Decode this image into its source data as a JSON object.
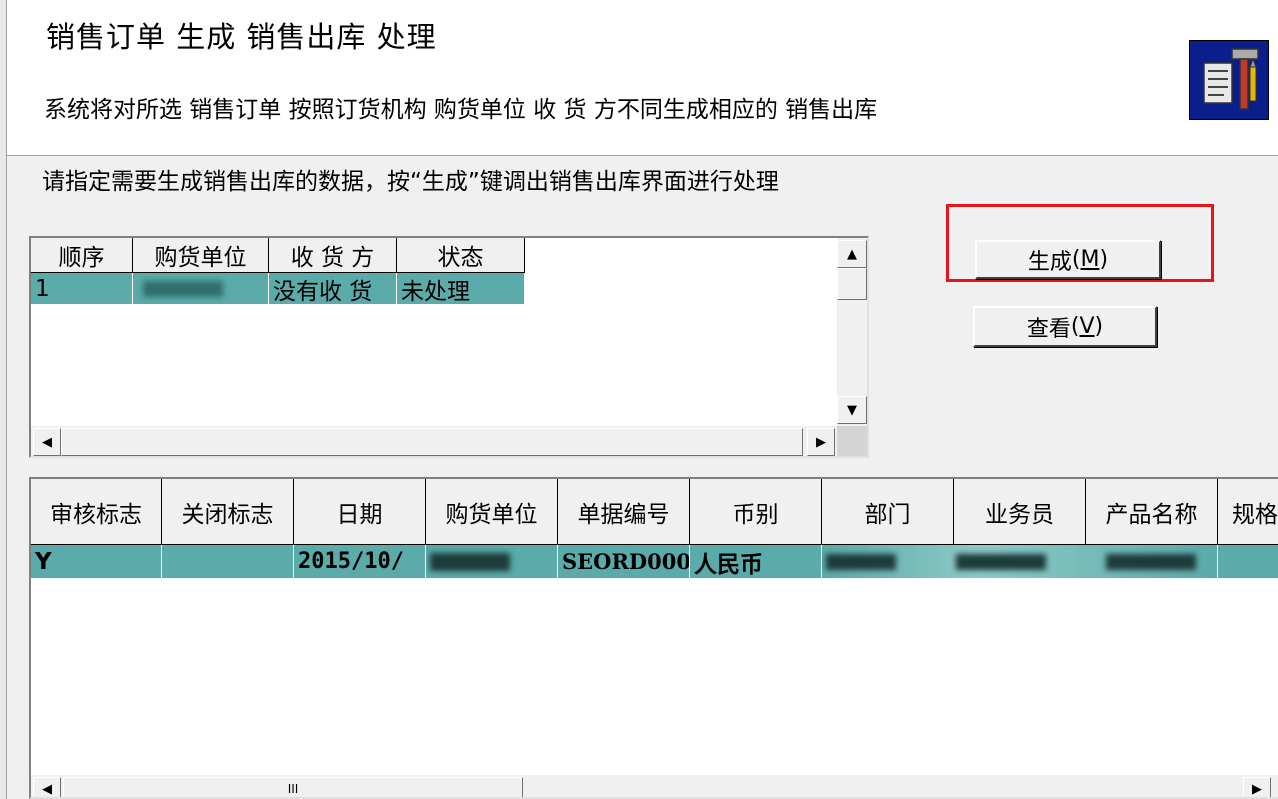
{
  "header": {
    "title": "销售订单 生成 销售出库 处理",
    "description": "系统将对所选 销售订单 按照订货机构 购货单位 收 货 方不同生成相应的 销售出库"
  },
  "instruction": "请指定需要生成销售出库的数据，按“生成”键调出销售出库界面进行处理",
  "buttons": {
    "generate_label": "生成",
    "generate_key": "M",
    "view_label": "查看",
    "view_key": "V"
  },
  "top_grid": {
    "columns": [
      "顺序",
      "购货单位",
      "收 货 方",
      "状态"
    ],
    "rows": [
      {
        "seq": "1",
        "buyer": "",
        "receiver": "没有收 货",
        "status": "未处理"
      }
    ]
  },
  "bottom_grid": {
    "columns": [
      "审核标志",
      "关闭标志",
      "日期",
      "购货单位",
      "单据编号",
      "币别",
      "部门",
      "业务员",
      "产品名称",
      "规格"
    ],
    "rows": [
      {
        "audit": "Y",
        "closed": "",
        "date": "2015/10/",
        "buyer": "",
        "doc_no": "SEORD000",
        "currency": "人民币",
        "dept": "",
        "salesman": "",
        "product": ""
      }
    ],
    "hscroll_grip": "III"
  },
  "colors": {
    "selected_row": "#5aaba9",
    "highlight_box": "#e8141a"
  }
}
